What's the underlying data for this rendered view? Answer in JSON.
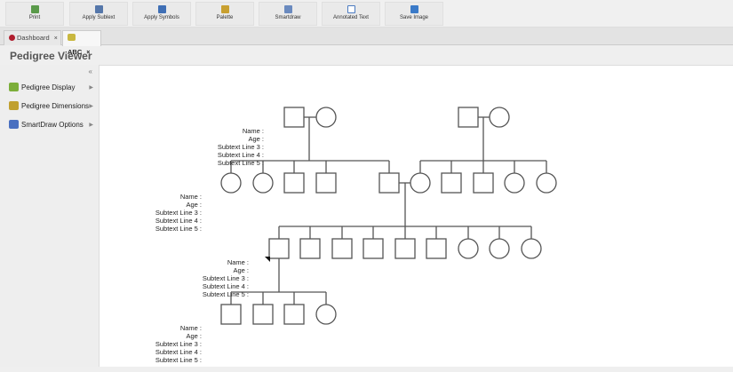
{
  "toolbar": [
    {
      "label": "Print",
      "icon": "printer-icon",
      "color": "#5a9a4a"
    },
    {
      "label": "Apply Sublext",
      "icon": "apply-subtext-icon",
      "color": "#5577aa"
    },
    {
      "label": "Apply Symbols",
      "icon": "apply-symbols-icon",
      "color": "#3f6fb5"
    },
    {
      "label": "Palette",
      "icon": "palette-icon",
      "color": "#c8a030"
    },
    {
      "label": "Smartdraw",
      "icon": "smartdraw-icon",
      "color": "#6a8abf"
    },
    {
      "label": "Annotated Text",
      "icon": "annotated-text-icon",
      "color": "#4a7ac0"
    },
    {
      "label": "Save Image",
      "icon": "save-image-icon",
      "color": "#3a7ac8"
    }
  ],
  "tabs": [
    {
      "label": "Dashboard",
      "close": "×"
    },
    {
      "label": "ABC",
      "close": "×"
    }
  ],
  "page_title": "Pedigree Viewer",
  "sidebar": {
    "collapse": "«",
    "items": [
      {
        "label": "Pedigree Display",
        "color": "#7cae3a"
      },
      {
        "label": "Pedigree Dimensions",
        "color": "#c0a030"
      },
      {
        "label": "SmartDraw Options",
        "color": "#4a70c0"
      }
    ]
  },
  "annotation_lines": [
    "Name :",
    "Age :",
    "Subtext Line 3 :",
    "Subtext Line 4 :",
    "Subtext Line 5 :"
  ]
}
